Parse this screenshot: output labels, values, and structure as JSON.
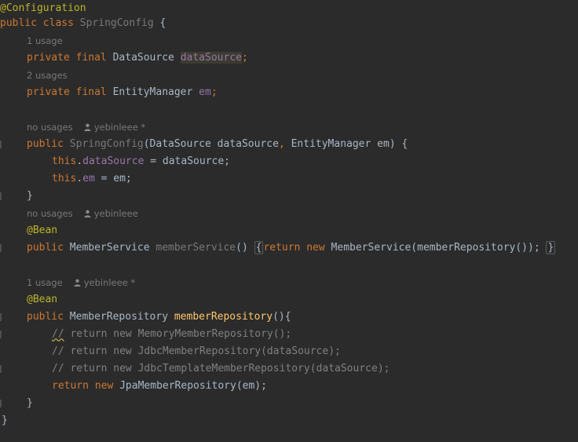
{
  "code": {
    "annotation_configuration": "@Configuration",
    "kw_public": "public",
    "kw_class": "class",
    "class_name": "SpringConfig",
    "brace_open": "{",
    "brace_close": "}",
    "kw_private": "private",
    "kw_final": "final",
    "type_datasource": "DataSource",
    "field_datasource": "dataSource",
    "semicolon": ";",
    "type_entitymanager": "EntityManager",
    "field_em": "em",
    "ctor_name": "SpringConfig",
    "ctor_params_open": "(",
    "param_datasource": "dataSource",
    "comma": ", ",
    "param_em": "em",
    "ctor_params_close": ") {",
    "kw_this": "this",
    "dot": ".",
    "assign_datasource": " = dataSource;",
    "assign_em": " = em;",
    "annotation_bean": "@Bean",
    "type_memberservice": "MemberService",
    "method_memberservice": "memberService",
    "parens": "()",
    "kw_return": "return",
    "kw_new": "new",
    "memberservice_call": "MemberService(memberRepository());",
    "type_memberrepository": "MemberRepository",
    "method_memberrepository": "memberRepository",
    "method_memberrepository_tail": "(){",
    "comment_slashes": "//",
    "comment_memory": " return new MemoryMemberRepository();",
    "comment_jdbc": "// return new JdbcMemberRepository(dataSource);",
    "comment_jdbctemplate": "// return new JdbcTemplateMemberRepository(dataSource);",
    "jpa_call": "JpaMemberRepository(em);"
  },
  "hints": {
    "usage_1": "1 usage",
    "usages_2": "2 usages",
    "no_usages": "no usages",
    "author_yebinleee_star": "yebinleee *",
    "author_yebinleee": "yebinleee"
  },
  "colors": {
    "background": "#2b2b2b",
    "keyword": "#cc7832",
    "annotation": "#bbb529",
    "field": "#9876aa",
    "method_decl": "#ffc66d",
    "comment": "#808080",
    "hint": "#787878"
  },
  "icons": [
    "person-icon"
  ]
}
